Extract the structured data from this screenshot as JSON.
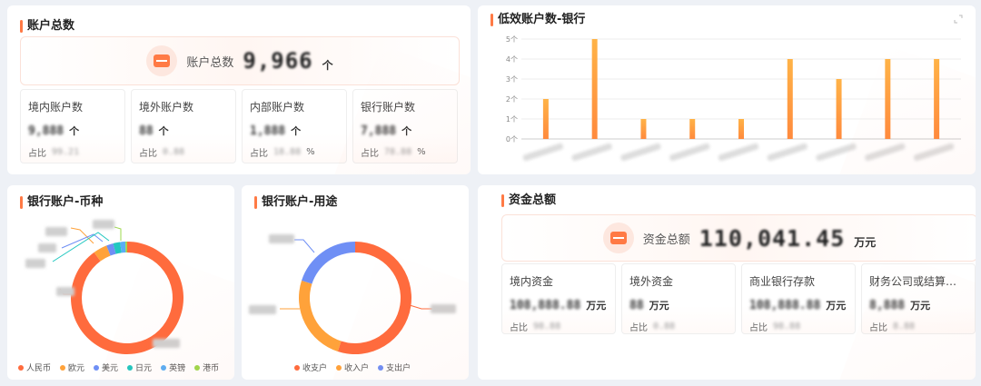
{
  "accounts": {
    "title": "账户总数",
    "hero": {
      "label": "账户总数",
      "value": "9,966",
      "unit": "个"
    },
    "cards": [
      {
        "title": "境内账户数",
        "value": "9,888",
        "unit": "个",
        "ratio_label": "占比",
        "ratio": "99.21",
        "ratio_unit": ""
      },
      {
        "title": "境外账户数",
        "value": "88",
        "unit": "个",
        "ratio_label": "占比",
        "ratio": "0.88",
        "ratio_unit": ""
      },
      {
        "title": "内部账户数",
        "value": "1,888",
        "unit": "个",
        "ratio_label": "占比",
        "ratio": "18.88",
        "ratio_unit": "%"
      },
      {
        "title": "银行账户数",
        "value": "7,888",
        "unit": "个",
        "ratio_label": "占比",
        "ratio": "78.88",
        "ratio_unit": "%"
      }
    ]
  },
  "low_eff": {
    "title": "低效账户数-银行",
    "expand_icon": "expand-icon"
  },
  "currency": {
    "title": "银行账户-币种",
    "legend": [
      {
        "name": "人民币",
        "color": "#ff6b3d"
      },
      {
        "name": "欧元",
        "color": "#ffa23a"
      },
      {
        "name": "美元",
        "color": "#6f8ff5"
      },
      {
        "name": "日元",
        "color": "#20c7c0"
      },
      {
        "name": "英镑",
        "color": "#5aaef5"
      },
      {
        "name": "港币",
        "color": "#9ed84c"
      }
    ]
  },
  "purpose": {
    "title": "银行账户-用途",
    "legend": [
      {
        "name": "收支户",
        "color": "#ff6b3d"
      },
      {
        "name": "收入户",
        "color": "#ffa23a"
      },
      {
        "name": "支出户",
        "color": "#6f8ff5"
      }
    ]
  },
  "funds": {
    "title": "资金总额",
    "hero": {
      "label": "资金总额",
      "value": "110,041.45",
      "unit": "万元"
    },
    "cards": [
      {
        "title": "境内资金",
        "value": "108,888.88",
        "unit": "万元",
        "ratio_label": "占比",
        "ratio": "98.88"
      },
      {
        "title": "境外资金",
        "value": "88",
        "unit": "万元",
        "ratio_label": "占比",
        "ratio": "0.88"
      },
      {
        "title": "商业银行存款",
        "value": "108,888.88",
        "unit": "万元",
        "ratio_label": "占比",
        "ratio": "98.88"
      },
      {
        "title": "财务公司或结算中心...",
        "value": "8,888",
        "unit": "万元",
        "ratio_label": "占比",
        "ratio": "8.88"
      }
    ]
  },
  "chart_data": [
    {
      "type": "bar",
      "title": "低效账户数-银行",
      "categories": [
        "",
        "",
        "",
        "",
        "",
        "",
        "",
        "",
        ""
      ],
      "values": [
        2,
        5,
        1,
        1,
        1,
        4,
        3,
        4,
        4
      ],
      "ylim": [
        0,
        5
      ],
      "yticks": [
        "0个",
        "1个",
        "2个",
        "3个",
        "4个",
        "5个"
      ],
      "grid": true,
      "color": "#ffa23a"
    },
    {
      "type": "pie",
      "title": "银行账户-币种",
      "labels": [
        "人民币",
        "欧元",
        "美元",
        "日元",
        "英镑",
        "港币"
      ],
      "values": [
        90,
        4,
        2,
        2,
        1.5,
        0.5
      ],
      "colors": [
        "#ff6b3d",
        "#ffa23a",
        "#6f8ff5",
        "#20c7c0",
        "#5aaef5",
        "#9ed84c"
      ],
      "legend": "bottom"
    },
    {
      "type": "pie",
      "title": "银行账户-用途",
      "labels": [
        "收支户",
        "收入户",
        "支出户"
      ],
      "values": [
        55,
        25,
        20
      ],
      "colors": [
        "#ff6b3d",
        "#ffa23a",
        "#6f8ff5"
      ],
      "legend": "bottom"
    }
  ]
}
